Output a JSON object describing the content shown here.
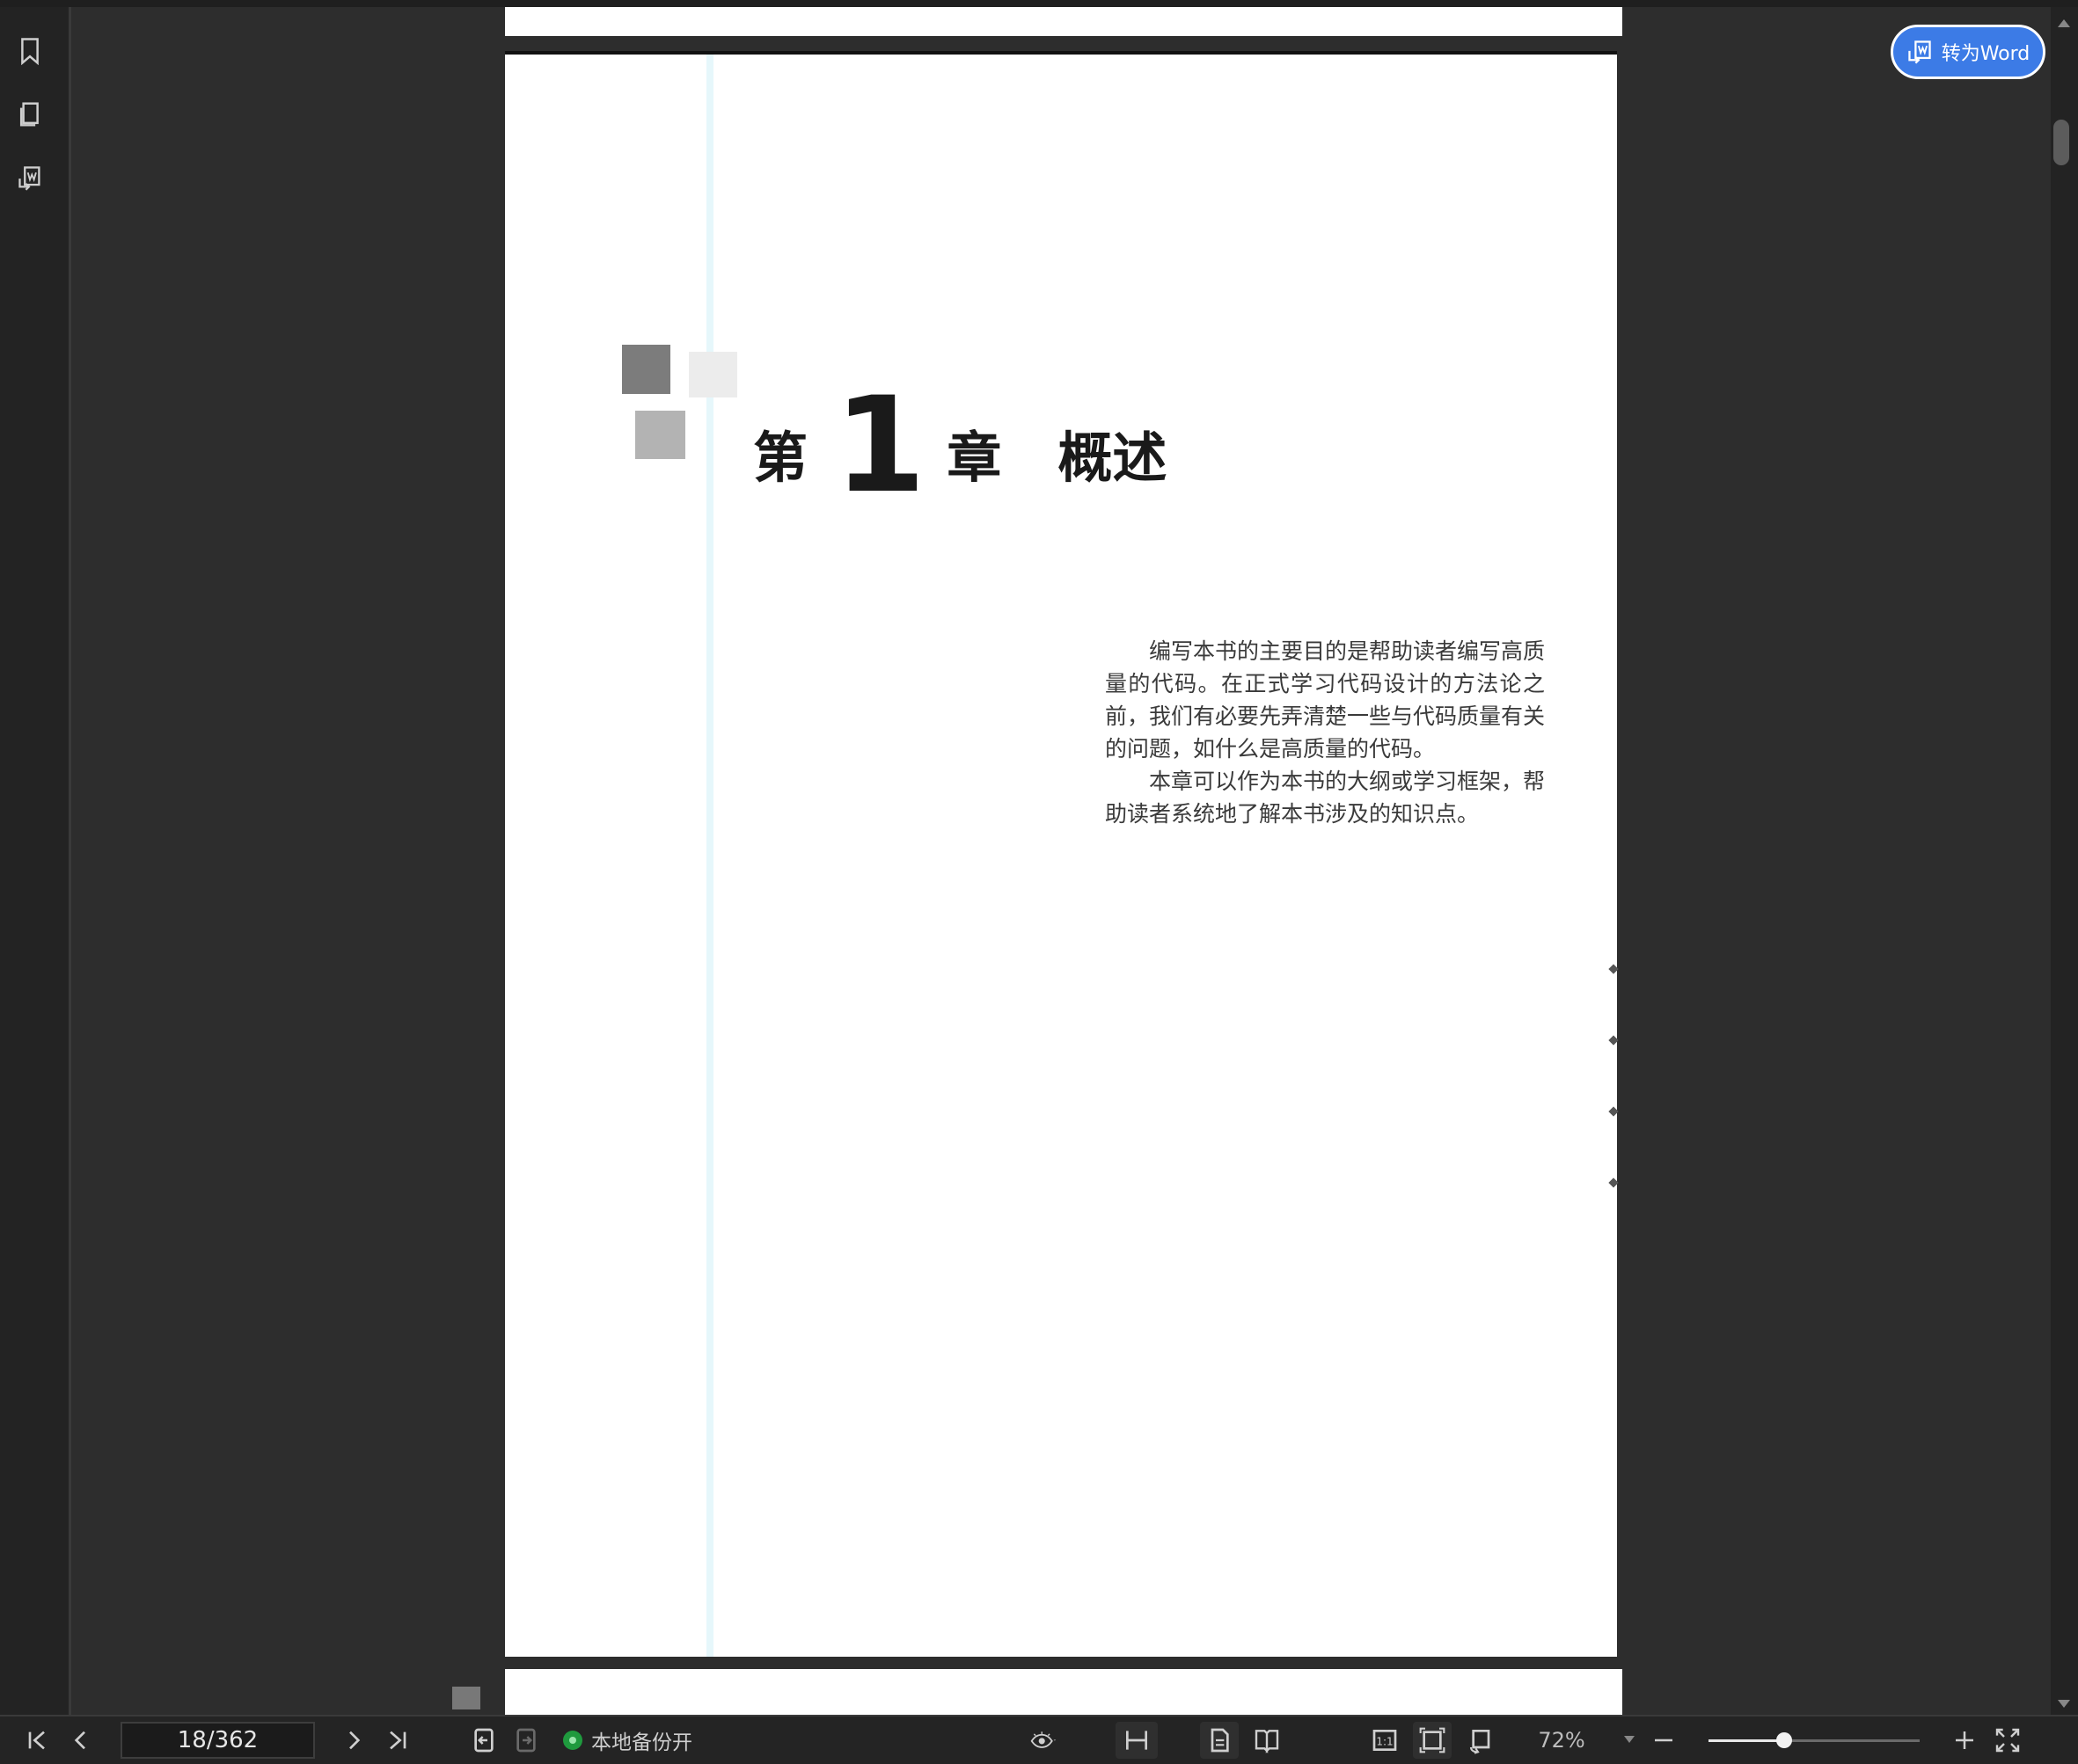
{
  "sidebar": {
    "items": [
      {
        "name": "bookmark",
        "icon": "bookmark-icon"
      },
      {
        "name": "thumbnails",
        "icon": "pages-icon"
      },
      {
        "name": "convert",
        "icon": "convert-to-word-icon"
      }
    ]
  },
  "document": {
    "chapter_prefix": "第",
    "chapter_number": "1",
    "chapter_suffix": "章",
    "chapter_title": "概述",
    "intro_paragraph_1": "编写本书的主要目的是帮助读者编写高质量的代码。在正式学习代码设计的方法论之前，我们有必要先弄清楚一些与代码质量有关的问题，如什么是高质量的代码。",
    "intro_paragraph_2": "本章可以作为本书的大纲或学习框架，帮助读者系统地了解本书涉及的知识点。"
  },
  "convert_button": {
    "label": "转为Word",
    "icon": "word-convert-icon",
    "color": "#3c7be6"
  },
  "toolbar": {
    "page_indicator": "18/362",
    "backup_status": "本地备份开",
    "backup_color": "#1f9a3e",
    "zoom_label": "72%",
    "zoom_level": 0.36
  },
  "colors": {
    "background": "#2b2b2b",
    "page": "#ffffff",
    "accent": "#3c7be6"
  }
}
